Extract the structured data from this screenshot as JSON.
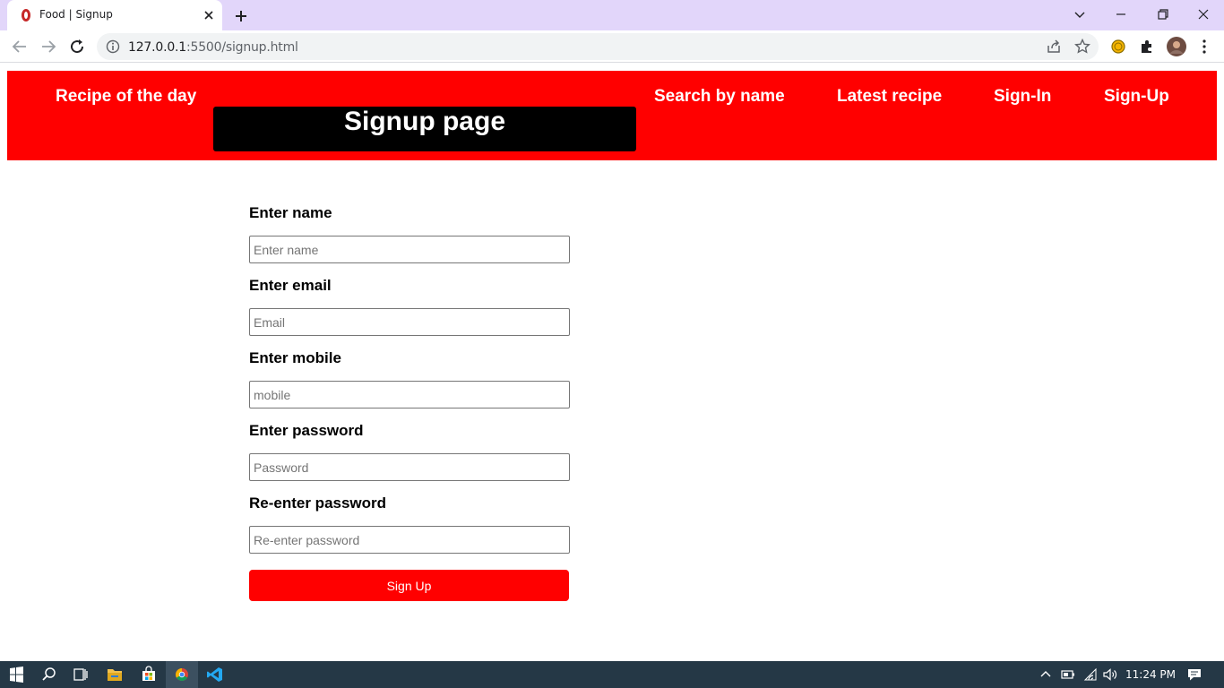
{
  "browser": {
    "tab_title": "Food | Signup",
    "url_host": "127.0.0.1",
    "url_rest": ":5500/signup.html"
  },
  "navbar": {
    "recipe_of_day": "Recipe of the day",
    "search_by_name": "Search by name",
    "latest_recipe": "Latest recipe",
    "sign_in": "Sign-In",
    "sign_up": "Sign-Up",
    "page_title": "Signup page"
  },
  "form": {
    "name_label": "Enter name",
    "name_placeholder": "Enter name",
    "email_label": "Enter email",
    "email_placeholder": "Email",
    "mobile_label": "Enter mobile",
    "mobile_placeholder": "mobile",
    "password_label": "Enter password",
    "password_placeholder": "Password",
    "reenter_label": "Re-enter password",
    "reenter_placeholder": "Re-enter password",
    "submit_label": "Sign Up"
  },
  "taskbar": {
    "time": "11:24 PM"
  },
  "colors": {
    "navbar_bg": "#ff0000",
    "title_bg": "#000000",
    "button_bg": "#ff0000",
    "tabstrip_bg": "#e2d6fa"
  }
}
